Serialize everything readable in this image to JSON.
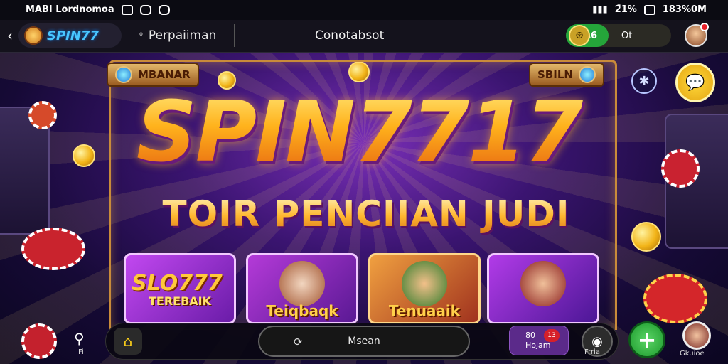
{
  "status_bar": {
    "left_text": "MABI Lordnomoa",
    "right_battery": "2̈1%",
    "right_time": "183%0M"
  },
  "nav": {
    "brand_logo": "SPIN77",
    "url_text": "Perpaiiman",
    "page_title": "Conotabsot",
    "balance_amount": "8A6",
    "balance_currency": "Ot"
  },
  "banner": {
    "plaque_left": "MBANAR",
    "plaque_right": "SBILN",
    "main_logo": "SPIN7717",
    "subheadline": "TOIR PENCIIAN JUDI"
  },
  "cards": [
    {
      "title": "SLO777",
      "caption": "TEREBAIK"
    },
    {
      "caption": "Teiqbaqk"
    },
    {
      "caption": "Tenuaaik"
    },
    {
      "caption": ""
    }
  ],
  "bottom": {
    "search_label": "Fi",
    "message_placeholder": "Msean",
    "game_btn_line1": "80",
    "game_btn_line2": "Hojam",
    "game_badge": "13",
    "camera_label": "Frria",
    "avatar_label": "Gkuioe"
  },
  "colors": {
    "accent_green": "#25a53a",
    "accent_gold": "#ffb21c",
    "accent_purple": "#7a2fb8"
  }
}
